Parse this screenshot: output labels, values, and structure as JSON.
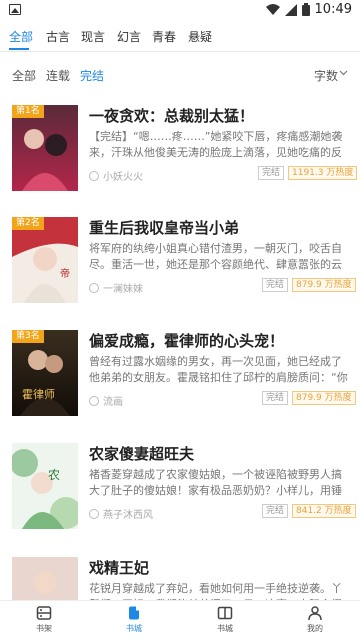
{
  "status_bar": {
    "time": "10:49",
    "icons": [
      "image-icon",
      "wifi-icon",
      "signal-icon",
      "battery-icon"
    ]
  },
  "category_tabs": [
    {
      "label": "全部",
      "active": true
    },
    {
      "label": "古言"
    },
    {
      "label": "现言"
    },
    {
      "label": "幻言"
    },
    {
      "label": "青春"
    },
    {
      "label": "悬疑"
    }
  ],
  "filters": {
    "items": [
      {
        "label": "全部"
      },
      {
        "label": "连载"
      },
      {
        "label": "完结",
        "active": true
      }
    ],
    "sort_label": "字数"
  },
  "books": [
    {
      "rank": "第1名",
      "title": "一夜贪欢：总裁别太猛！",
      "desc": "【完结】“嗯……疼……”她紧咬下唇，疼痛感潮她袭来，汗珠从他俊美无涛的脸庞上滴落，见她吃痛的反应，他不由一惊，疼惜的表情瞬间被冷漠所代替。“唔……好疼，不要了……”",
      "author": "小妖火火",
      "status": "完结",
      "hot": "1191.3 万热度"
    },
    {
      "rank": "第2名",
      "title": "重生后我収皇帝当小弟",
      "desc": "将军府的纨绔小姐真心错付渣男，一朝灭门，咬舌自尽。重活一世，她还是那个容颜绝代、肆意嚣张的云安歌！虽然要改过自新，但“京城三霸”少了她可不行。身负系统空间，",
      "author": "一澜妹妹",
      "status": "完结",
      "hot": "879.9 万热度"
    },
    {
      "rank": "第3名",
      "title": "偏爱成瘾，霍律师的心头宠！",
      "desc": "曾经有过露水姻缘的男女，再一次见面，她已经成了他弟弟的女朋友。霍晟铭扣住了邱柠的肩膀质问：“你跟我睡过还跟我弟弟在一起？”邱柠笑得云淡风轻，“那你就当我是来",
      "author": "流画",
      "status": "完结",
      "hot": "879.9 万热度"
    },
    {
      "rank": "",
      "title": "农家傻妻超旺夫",
      "desc": "褚香菱穿越成了农家傻姑娘，一个被诬陷被野男人搞大了肚子的傻姑娘！家有极品恶奶奶？小样儿，用锤子扎死她！外有抠门门男神？没事儿，用金子砸晕他！！都说傻子不认",
      "author": "燕子沐西风",
      "status": "完结",
      "hot": "841.2 万热度"
    },
    {
      "rank": "",
      "title": "戏精王妃",
      "desc": "花锐月穿越成了弃妃，看她如何用一手绝技逆袭。丫鬟们：王妃，我们能关着门了，日，这事，太阳会得枕，耶，",
      "author": "",
      "status": "",
      "hot": ""
    }
  ],
  "bottom_nav": [
    {
      "label": "书架"
    },
    {
      "label": "书城",
      "active": true
    },
    {
      "label": "书城"
    },
    {
      "label": "我的"
    }
  ]
}
